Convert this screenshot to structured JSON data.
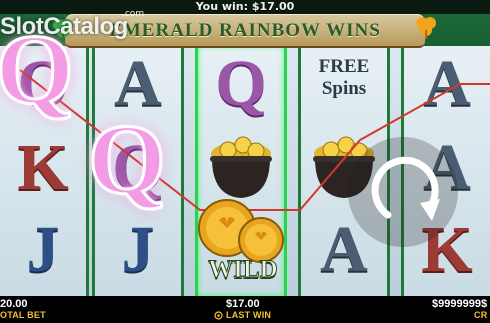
{
  "header": {
    "you_win": "You win: $17.00"
  },
  "watermark": {
    "brand": "SlotCatalog",
    "suffix": ".com"
  },
  "game": {
    "title": "EMERALD RAINBOW WINS"
  },
  "reels": {
    "columns": [
      [
        "Q",
        "K",
        "J"
      ],
      [
        "A",
        "Q",
        "J"
      ],
      [
        "Q",
        "POT",
        "WILD"
      ],
      [
        "FREE SPINS",
        "POT",
        "A"
      ],
      [
        "A",
        "A",
        "K"
      ]
    ],
    "free_spins_label_1": "FREE",
    "free_spins_label_2": "Spins",
    "wild_label": "WILD",
    "highlighted_q": "Q"
  },
  "controls": {
    "total_bet_value": "20.00",
    "total_bet_label": "OTAL BET",
    "last_win_value": "$17.00",
    "last_win_label": "LAST WIN",
    "credit_value": "$9999999$",
    "credit_label": "CR",
    "spin_icon": "spin-arrow-icon"
  },
  "colors": {
    "reel_border": "#1f7a3a",
    "win_line": "#d2382f",
    "label_gold": "#f2c230",
    "highlight_q": "#f39be5"
  }
}
